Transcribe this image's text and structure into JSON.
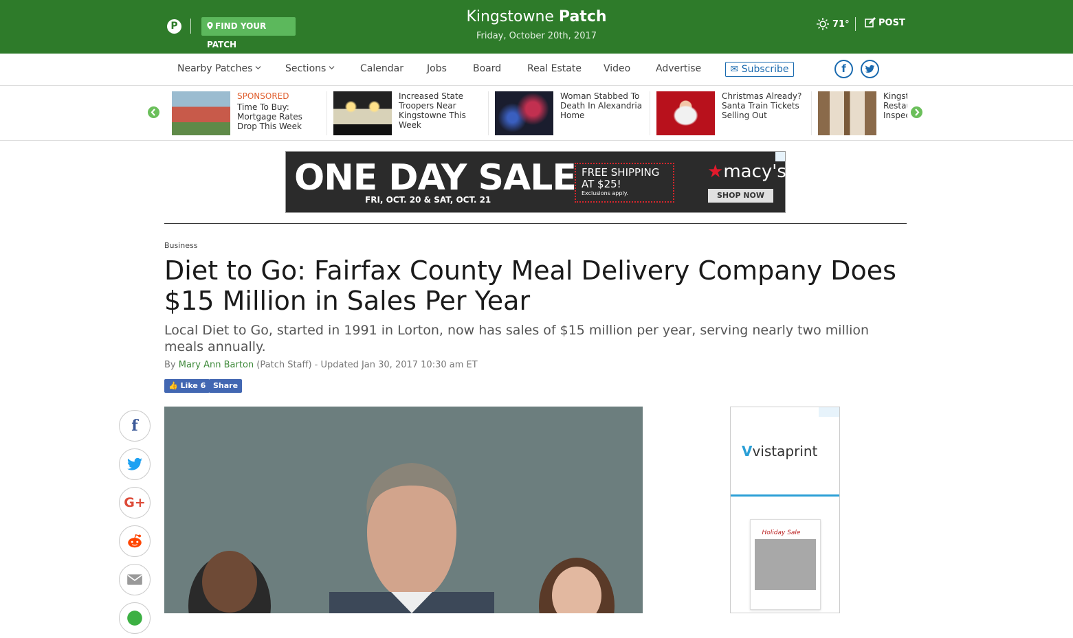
{
  "header": {
    "logo_letter": "P",
    "find_patch_label": "FIND YOUR PATCH",
    "site_name": "Kingstowne",
    "site_brand": "Patch",
    "date": "Friday, October 20th, 2017",
    "temperature": "71°",
    "post_label": "POST"
  },
  "nav": {
    "items": [
      {
        "label": "Nearby Patches",
        "dropdown": true
      },
      {
        "label": "Sections",
        "dropdown": true
      },
      {
        "label": "Calendar"
      },
      {
        "label": "Jobs"
      },
      {
        "label": "Board"
      },
      {
        "label": "Real Estate"
      },
      {
        "label": "Video"
      },
      {
        "label": "Advertise"
      }
    ],
    "subscribe_label": "Subscribe",
    "facebook_glyph": "f",
    "twitter_glyph": "t"
  },
  "carousel": {
    "items": [
      {
        "tag": "SPONSORED",
        "title": "Time To Buy: Mortgage Rates Drop This Week"
      },
      {
        "tag": "",
        "title": "Increased State Troopers Near Kingstowne This Week"
      },
      {
        "tag": "",
        "title": "Woman Stabbed To Death In Alexandria Home"
      },
      {
        "tag": "",
        "title": "Christmas Already? Santa Train Tickets Selling Out"
      },
      {
        "tag": "",
        "title": "Kingstowne Restaurant Inspections October"
      }
    ]
  },
  "banner_ad": {
    "headline": "ONE DAY SALE",
    "dates": "FRI, OCT. 20 & SAT, OCT. 21",
    "shipping_line1": "FREE SHIPPING",
    "shipping_line2": "AT $25!",
    "shipping_note": "Exclusions apply.",
    "brand": "macy's",
    "cta": "SHOP NOW"
  },
  "article": {
    "category": "Business",
    "headline": "Diet to Go: Fairfax County Meal Delivery Company Does $15 Million in Sales Per Year",
    "subhead": "Local Diet to Go, started in 1991 in Lorton, now has sales of $15 million per year, serving nearly two million meals annually.",
    "byline_prefix": "By",
    "author": "Mary Ann Barton",
    "byline_suffix": "(Patch Staff) - Updated Jan 30, 2017 10:30 am ET",
    "like_label": "Like 6",
    "share_label": "Share"
  },
  "share_rail": [
    {
      "icon": "facebook-icon",
      "glyph": "f",
      "color": "#3b5998"
    },
    {
      "icon": "twitter-icon",
      "glyph": "🐦",
      "color": "#1da1f2"
    },
    {
      "icon": "google-plus-icon",
      "glyph": "G+",
      "color": "#dd4b39"
    },
    {
      "icon": "reddit-icon",
      "glyph": "●",
      "color": "#ff4500"
    },
    {
      "icon": "email-icon",
      "glyph": "✉",
      "color": "#888888"
    }
  ],
  "side_ad": {
    "brand": "vistaprint",
    "card_title": "Holiday Sale"
  },
  "colors": {
    "header_green": "#2e7b2a",
    "button_green": "#5cb85c",
    "link_blue": "#1a6aaf",
    "author_green": "#3e8a3a"
  }
}
